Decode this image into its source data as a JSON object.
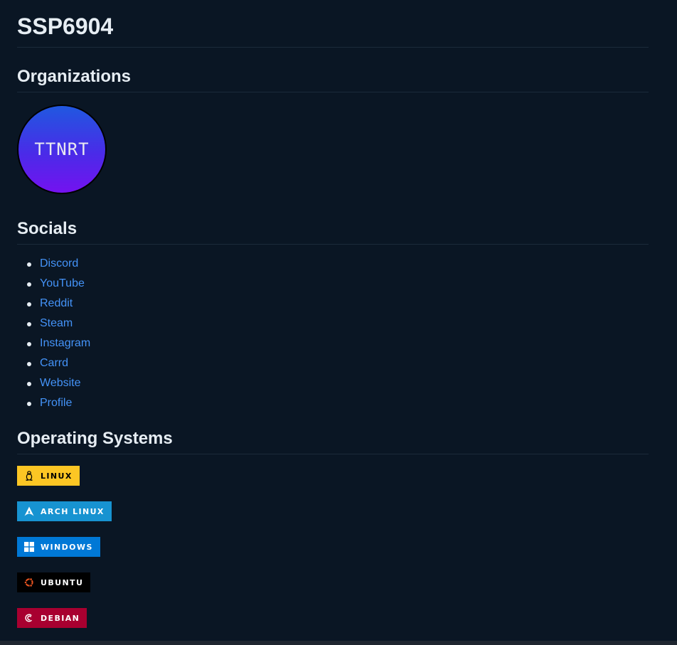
{
  "profile": {
    "title": "SSP6904"
  },
  "organizations": {
    "heading": "Organizations",
    "items": [
      {
        "label": "TTNRT"
      }
    ]
  },
  "socials": {
    "heading": "Socials",
    "links": [
      {
        "label": "Discord"
      },
      {
        "label": "YouTube"
      },
      {
        "label": "Reddit"
      },
      {
        "label": "Steam"
      },
      {
        "label": "Instagram"
      },
      {
        "label": "Carrd"
      },
      {
        "label": "Website"
      },
      {
        "label": "Profile"
      }
    ]
  },
  "operating_systems": {
    "heading": "Operating Systems",
    "badges": [
      {
        "label": "LINUX",
        "icon": "tux-icon",
        "bg": "#FCC624",
        "fg": "#000000"
      },
      {
        "label": "ARCH LINUX",
        "icon": "arch-linux-icon",
        "bg": "#1793D1",
        "fg": "#FFFFFF"
      },
      {
        "label": "WINDOWS",
        "icon": "windows-icon",
        "bg": "#0078D6",
        "fg": "#FFFFFF"
      },
      {
        "label": "UBUNTU",
        "icon": "ubuntu-icon",
        "bg": "#000000",
        "fg": "#FFFFFF"
      },
      {
        "label": "DEBIAN",
        "icon": "debian-icon",
        "bg": "#A80030",
        "fg": "#FFFFFF"
      }
    ]
  },
  "colors": {
    "background": "#0a1624",
    "link": "#4493f8",
    "text": "#e6edf3"
  }
}
